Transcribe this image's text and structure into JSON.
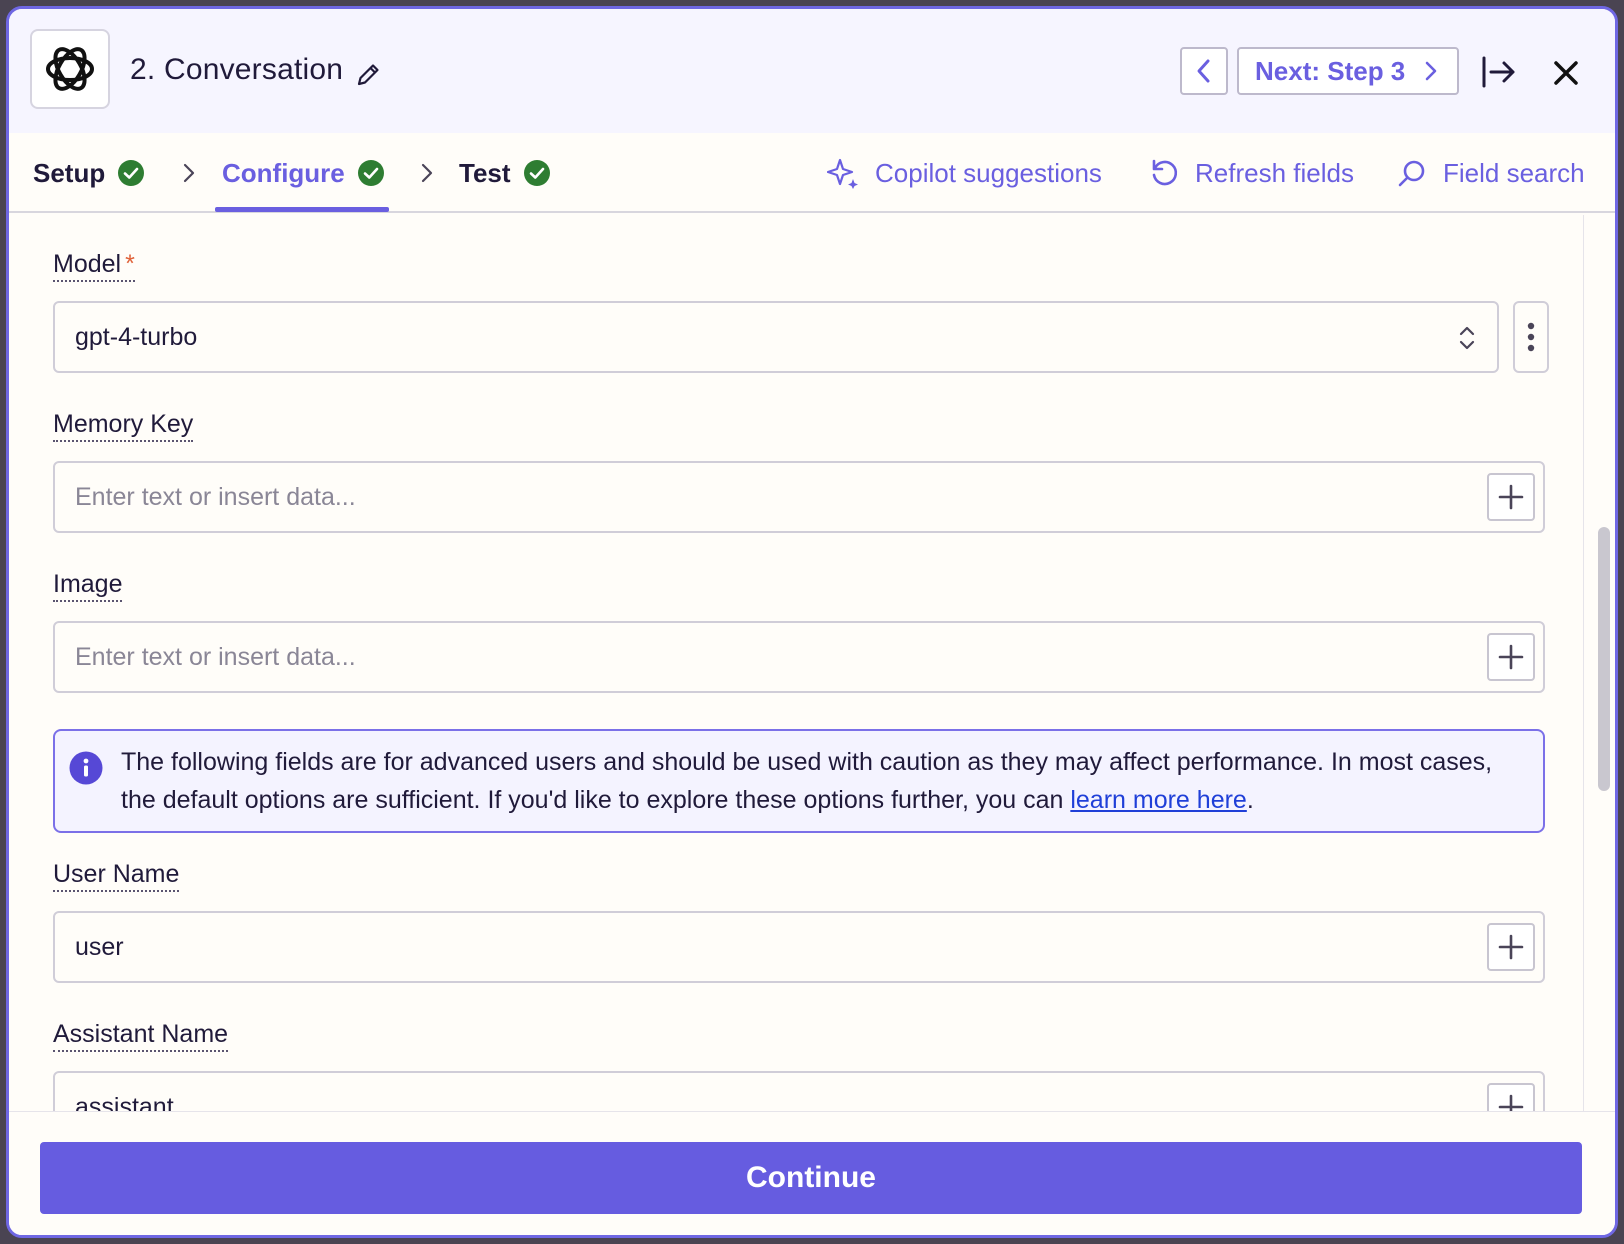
{
  "header": {
    "title": "2. Conversation",
    "next_label": "Next: Step 3"
  },
  "tabs": [
    {
      "label": "Setup",
      "status": "complete"
    },
    {
      "label": "Configure",
      "status": "complete",
      "active": true
    },
    {
      "label": "Test",
      "status": "complete"
    }
  ],
  "tools": {
    "copilot": "Copilot suggestions",
    "refresh": "Refresh fields",
    "search": "Field search"
  },
  "fields": {
    "model": {
      "label": "Model",
      "required_mark": "*",
      "value": "gpt-4-turbo"
    },
    "memory_key": {
      "label": "Memory Key",
      "placeholder": "Enter text or insert data..."
    },
    "image": {
      "label": "Image",
      "placeholder": "Enter text or insert data..."
    },
    "user_name": {
      "label": "User Name",
      "value": "user"
    },
    "assistant_name": {
      "label": "Assistant Name",
      "value": "assistant"
    }
  },
  "callout": {
    "text": "The following fields are for advanced users and should be used with caution as they may affect performance. In most cases, the default options are sufficient. If you'd like to explore these options further, you can ",
    "link": "learn more here",
    "suffix": "."
  },
  "footer": {
    "continue_label": "Continue"
  },
  "colors": {
    "accent": "#665ce0",
    "success": "#2e7d32",
    "required": "#e0623a",
    "link": "#1f3fd8"
  },
  "icons": [
    "openai-logo-icon",
    "pencil-icon",
    "chevron-left-icon",
    "chevron-right-icon",
    "expand-panel-icon",
    "close-icon",
    "check-circle-icon",
    "sparkle-icon",
    "refresh-icon",
    "search-icon",
    "info-icon",
    "plus-icon",
    "more-vertical-icon",
    "select-arrows-icon"
  ]
}
